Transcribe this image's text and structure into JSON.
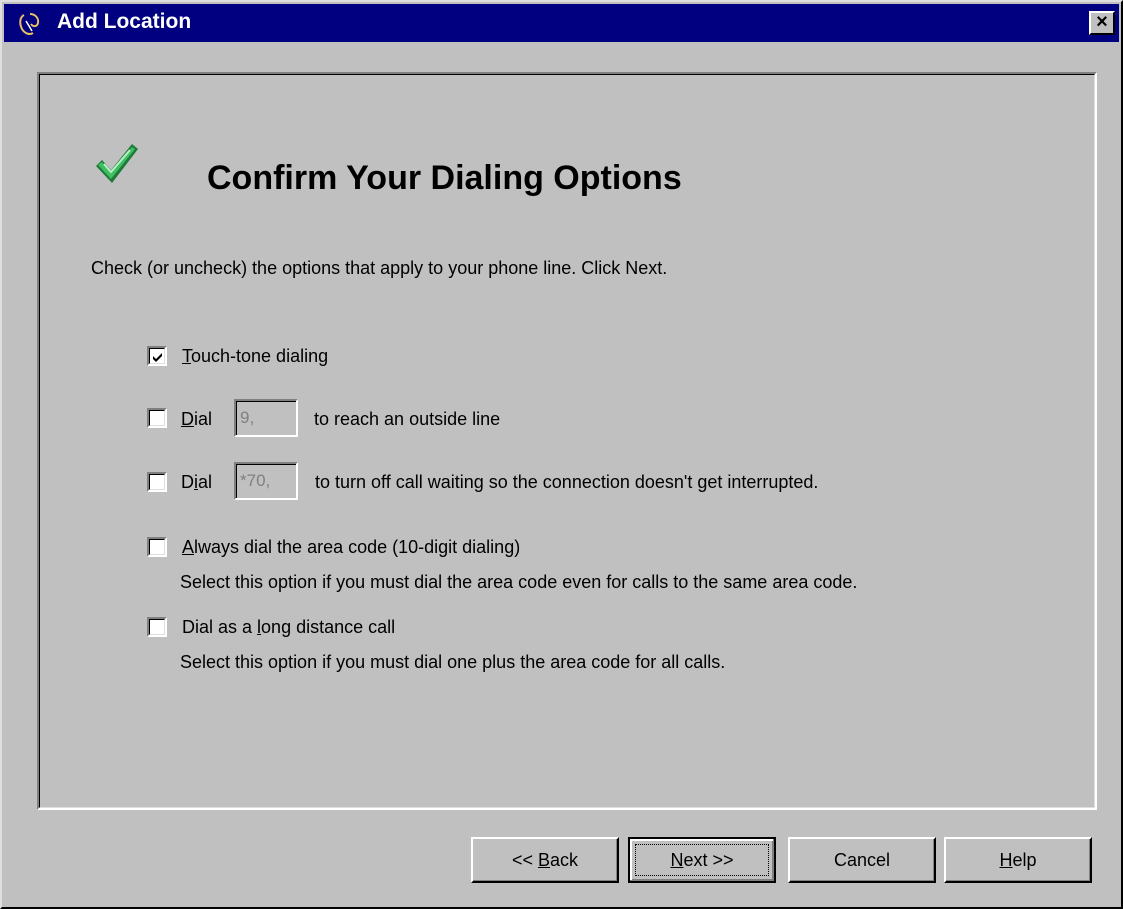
{
  "window": {
    "title": "Add Location",
    "title_icon": "telephony-icon",
    "close_label": "×"
  },
  "page": {
    "icon": "green-checkmark-icon",
    "heading": "Confirm Your Dialing Options",
    "instruction": "Check (or uncheck) the options that apply to your phone line. Click Next."
  },
  "options": {
    "touch_tone": {
      "checked": true,
      "mnemonic": "T",
      "label_rest": "ouch-tone dialing"
    },
    "outside_line": {
      "checked": false,
      "label_prefix": "",
      "mnemonic": "D",
      "label_after_mnemonic": "ial",
      "field_value": "9,",
      "suffix": "to reach an outside line"
    },
    "call_waiting": {
      "checked": false,
      "label_prefix": "D",
      "mnemonic": "i",
      "label_after_mnemonic": "al",
      "field_value": "*70,",
      "suffix": "to turn off call waiting so the connection doesn't get interrupted."
    },
    "area_code": {
      "checked": false,
      "mnemonic": "A",
      "label_rest": "lways dial the area code (10-digit dialing)",
      "description": "Select this option if you must dial the area code even for calls to the same area code."
    },
    "long_distance": {
      "checked": false,
      "label_prefix": "Dial as a ",
      "mnemonic": "l",
      "label_rest": "ong distance call",
      "description": "Select this option if you must dial one plus the area code for all calls."
    }
  },
  "buttons": {
    "back_prefix": "<< ",
    "back_mnemonic": "B",
    "back_rest": "ack",
    "next_mnemonic": "N",
    "next_rest": "ext >>",
    "cancel": "Cancel",
    "help_mnemonic": "H",
    "help_rest": "elp"
  },
  "colors": {
    "titlebar": "#000080",
    "dialog_face": "#c0c0c0",
    "checkmark": "#2fa84f"
  }
}
